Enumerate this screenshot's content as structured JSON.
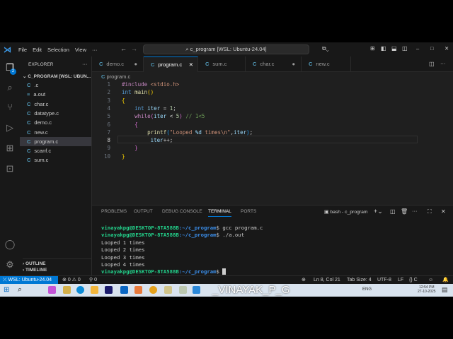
{
  "menu": {
    "file": "File",
    "edit": "Edit",
    "selection": "Selection",
    "view": "View",
    "more": "···"
  },
  "command_center": "c_program [WSL: Ubuntu-24.04]",
  "activity": {
    "explorer_badge": "2"
  },
  "sidebar": {
    "title": "EXPLORER",
    "folder": "C_PROGRAM [WSL: UBUN...",
    "files": [
      {
        "name": ".c",
        "type": "c"
      },
      {
        "name": "a.out",
        "type": "binary"
      },
      {
        "name": "char.c",
        "type": "c"
      },
      {
        "name": "datatype.c",
        "type": "c"
      },
      {
        "name": "demo.c",
        "type": "c"
      },
      {
        "name": "new.c",
        "type": "c"
      },
      {
        "name": "program.c",
        "type": "c",
        "selected": true
      },
      {
        "name": "scanf.c",
        "type": "c"
      },
      {
        "name": "sum.c",
        "type": "c"
      }
    ],
    "outline": "OUTLINE",
    "timeline": "TIMELINE"
  },
  "tabs": [
    {
      "label": "demo.c",
      "modified": true
    },
    {
      "label": "program.c",
      "active": true
    },
    {
      "label": "sum.c"
    },
    {
      "label": "char.c",
      "modified": true
    },
    {
      "label": "new.c"
    }
  ],
  "breadcrumb": "program.c",
  "code_lines": [
    "1",
    "2",
    "3",
    "4",
    "5",
    "6",
    "7",
    "8",
    "9",
    "10"
  ],
  "panel": {
    "tabs": [
      "PROBLEMS",
      "OUTPUT",
      "DEBUG CONSOLE",
      "TERMINAL",
      "PORTS"
    ],
    "active": "TERMINAL",
    "terminal_name": "bash - c_program"
  },
  "terminal": {
    "prompt": "vinayakpg@DESKTOP-8TA588B",
    "path": ":~/c_program",
    "cmd1": "$ gcc program.c",
    "cmd2": "$ ./a.out",
    "out": [
      "Looped 1 times",
      "Looped 2 times",
      "Looped 3 times",
      "Looped 4 times"
    ],
    "cmd3": "$ "
  },
  "status": {
    "remote": "WSL: Ubuntu-24.04",
    "errors": "0",
    "warnings": "0",
    "ports": "0",
    "position": "Ln 8, Col 21",
    "tab_size": "Tab Size: 4",
    "encoding": "UTF-8",
    "eol": "LF",
    "language": "C"
  },
  "taskbar": {
    "watermark": "_VINAYAK_P_G",
    "time": "12:54 PM",
    "date": "27-10-2025",
    "lang": "ENG"
  },
  "colors": {
    "accent": "#0078d4",
    "background": "#1f1f1f"
  }
}
